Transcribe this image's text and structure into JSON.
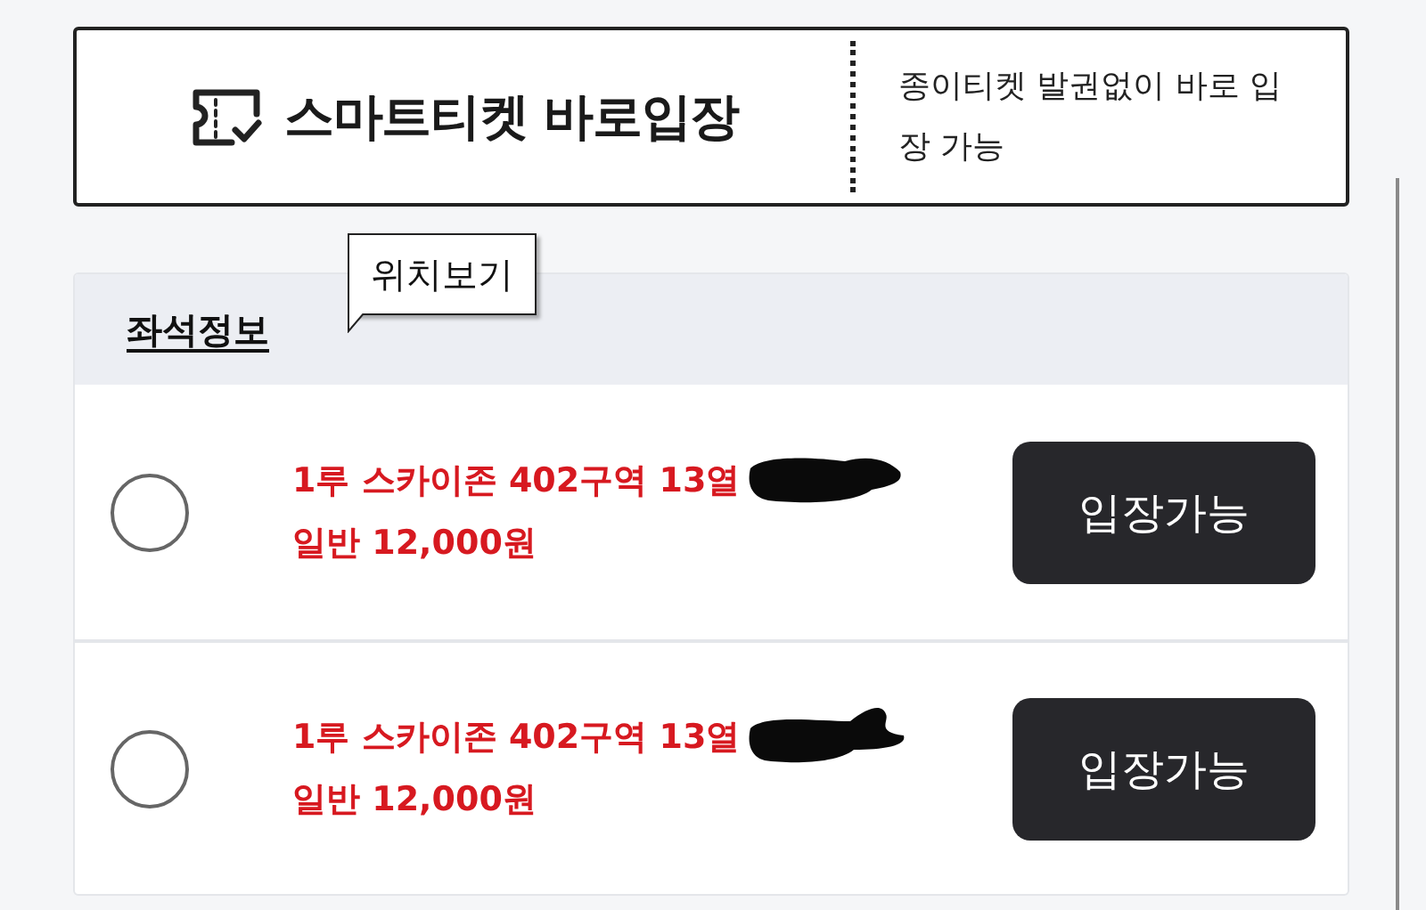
{
  "banner": {
    "title": "스마트티켓 바로입장",
    "description": "종이티켓 발권없이 바로 입장 가능"
  },
  "seat_info": {
    "heading": "좌석정보",
    "tooltip": "위치보기",
    "rows": [
      {
        "seat": "1루 스카이존 402구역 13열",
        "price": "일반 12,000원",
        "selected": false,
        "redacted": true,
        "button": "입장가능"
      },
      {
        "seat": "1루 스카이존 402구역 13열",
        "price": "일반 12,000원",
        "selected": false,
        "redacted": true,
        "button": "입장가능"
      }
    ]
  }
}
